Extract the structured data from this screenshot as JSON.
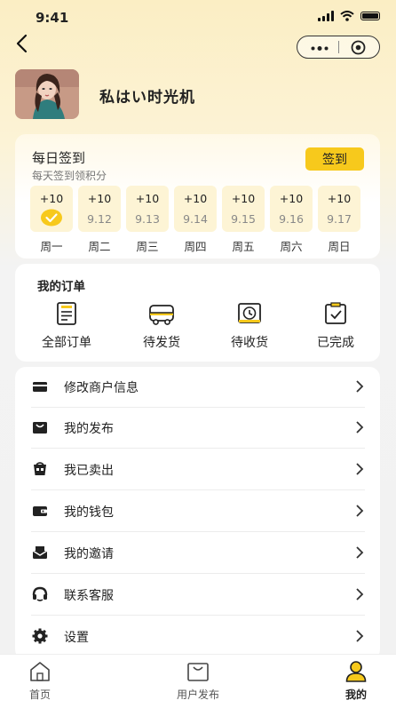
{
  "status_bar": {
    "time": "9:41"
  },
  "profile": {
    "username": "私はい时光机"
  },
  "checkin": {
    "title": "每日签到",
    "subtitle": "每天签到领积分",
    "button_label": "签到",
    "days": [
      {
        "points": "+10",
        "date": "",
        "label": "周一",
        "checked": true
      },
      {
        "points": "+10",
        "date": "9.12",
        "label": "周二",
        "checked": false
      },
      {
        "points": "+10",
        "date": "9.13",
        "label": "周三",
        "checked": false
      },
      {
        "points": "+10",
        "date": "9.14",
        "label": "周四",
        "checked": false
      },
      {
        "points": "+10",
        "date": "9.15",
        "label": "周五",
        "checked": false
      },
      {
        "points": "+10",
        "date": "9.16",
        "label": "周六",
        "checked": false
      },
      {
        "points": "+10",
        "date": "9.17",
        "label": "周日",
        "checked": false
      }
    ]
  },
  "orders": {
    "title": "我的订单",
    "items": [
      {
        "label": "全部订单",
        "icon": "order-list-icon"
      },
      {
        "label": "待发货",
        "icon": "truck-icon"
      },
      {
        "label": "待收货",
        "icon": "clock-box-icon"
      },
      {
        "label": "已完成",
        "icon": "check-clipboard-icon"
      }
    ]
  },
  "menu": {
    "items": [
      {
        "label": "修改商户信息",
        "icon": "store-icon"
      },
      {
        "label": "我的发布",
        "icon": "bag-icon"
      },
      {
        "label": "我已卖出",
        "icon": "sold-icon"
      },
      {
        "label": "我的钱包",
        "icon": "wallet-icon"
      },
      {
        "label": "我的邀请",
        "icon": "invite-envelope-icon"
      },
      {
        "label": "联系客服",
        "icon": "headset-icon"
      },
      {
        "label": "设置",
        "icon": "gear-icon"
      }
    ]
  },
  "tabbar": {
    "tabs": [
      {
        "label": "首页",
        "icon": "home-icon",
        "active": false
      },
      {
        "label": "用户发布",
        "icon": "publish-bag-icon",
        "active": false
      },
      {
        "label": "我的",
        "icon": "user-icon",
        "active": true
      }
    ]
  },
  "colors": {
    "accent": "#f7c91c",
    "day_bg": "#fdf4d5"
  }
}
